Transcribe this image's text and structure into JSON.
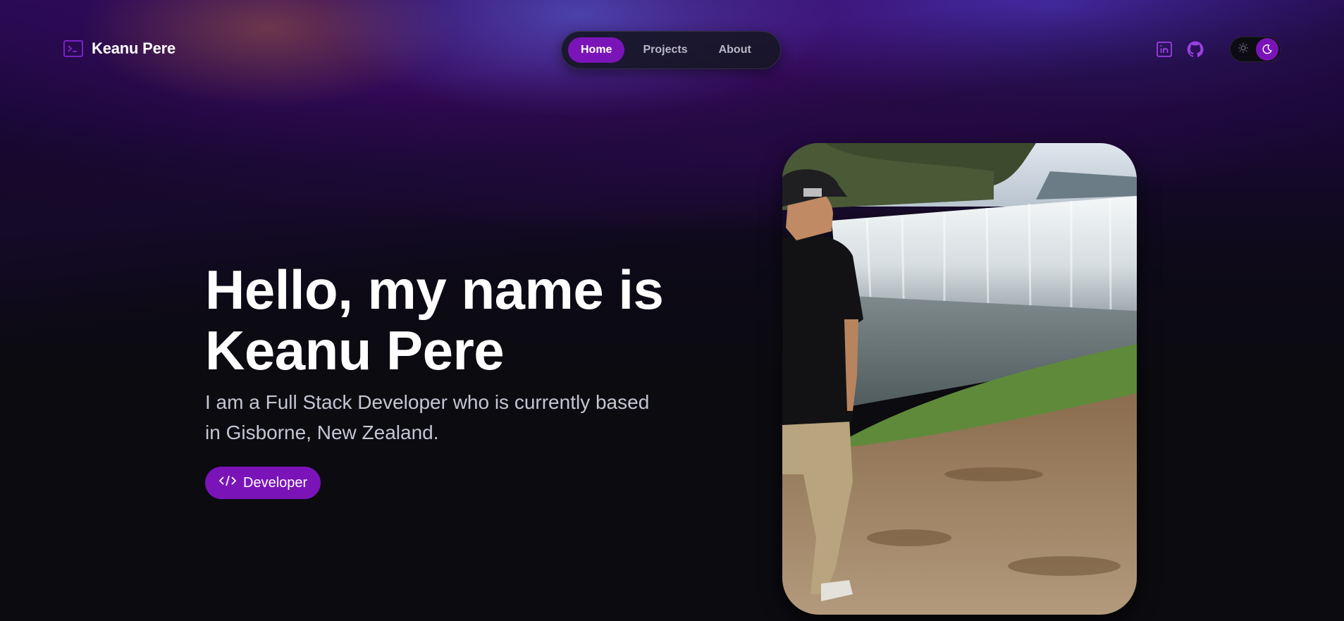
{
  "brand": {
    "name": "Keanu Pere",
    "icon": "terminal-icon",
    "accent_color": "#7a14b8"
  },
  "nav": {
    "tabs": [
      {
        "label": "Home",
        "active": true
      },
      {
        "label": "Projects",
        "active": false
      },
      {
        "label": "About",
        "active": false
      }
    ]
  },
  "header_actions": {
    "linkedin_icon": "linkedin-icon",
    "github_icon": "github-icon",
    "theme_toggle": {
      "light_icon": "sun-icon",
      "dark_icon": "moon-icon",
      "selected": "dark"
    }
  },
  "hero": {
    "title_line1": "Hello, my name is",
    "title_line2": "Keanu Pere",
    "subtitle": "I am a Full Stack Developer who is currently based in Gisborne, New Zealand.",
    "role_button": {
      "icon": "code-icon",
      "label": "Developer"
    }
  },
  "colors": {
    "background": "#0b0b10",
    "accent": "#7a14b8",
    "subtitle_text": "#c4c6d4"
  }
}
